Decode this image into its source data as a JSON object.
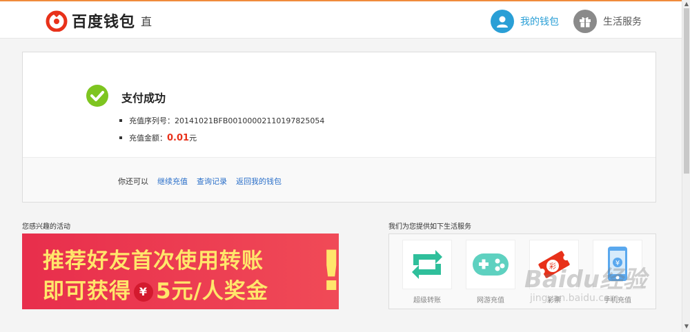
{
  "header": {
    "logo_text": "百度钱包",
    "logo_sub": "直",
    "nav": [
      {
        "label": "我的钱包",
        "color": "#2a9fd6"
      },
      {
        "label": "生活服务",
        "color": "#666666"
      }
    ]
  },
  "result": {
    "title": "支付成功",
    "serial_label": "充值序列号：",
    "serial_value": "20141021BFB00100002110197825054",
    "amount_label": "充值金额：",
    "amount_value": "0.01",
    "amount_unit": "元",
    "more_prefix": "你还可以",
    "links": [
      "继续充值",
      "查询记录",
      "返回我的钱包"
    ]
  },
  "activity": {
    "title": "您感兴趣的活动",
    "banner_line1": "推荐好友首次使用转账",
    "banner_line2_a": "即可获得",
    "banner_yen": "¥",
    "banner_line2_b": "5元/人奖金",
    "banner_excl": "!"
  },
  "services": {
    "title": "我们为您提供如下生活服务",
    "items": [
      {
        "label": "超级转账",
        "icon": "transfer-icon"
      },
      {
        "label": "网游充值",
        "icon": "gamepad-icon"
      },
      {
        "label": "彩票",
        "icon": "lottery-icon"
      },
      {
        "label": "手机充值",
        "icon": "phone-icon"
      }
    ],
    "lottery_char": "彩",
    "phone_symbol": "¥"
  },
  "watermark": {
    "main": "Baidu经验",
    "sub": "jingyan.baidu.com"
  }
}
